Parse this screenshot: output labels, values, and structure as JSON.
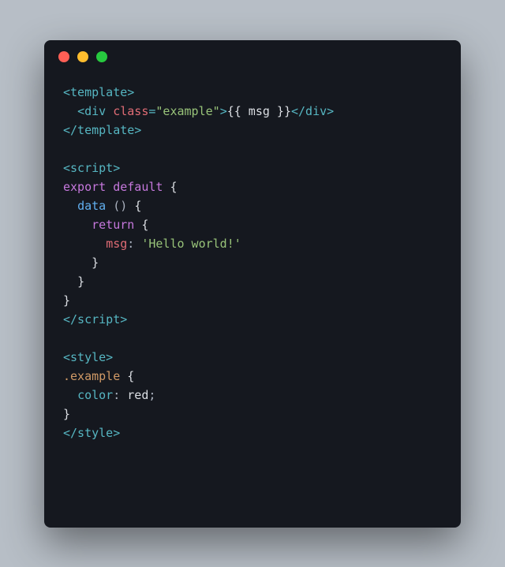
{
  "code": {
    "line1": {
      "open": "<template>"
    },
    "line2": {
      "indent": "  ",
      "lt": "<",
      "tag": "div",
      "sp": " ",
      "attr": "class",
      "eq": "=",
      "val": "\"example\"",
      "gt": ">",
      "mustache": "{{ msg }}",
      "close": "</div>"
    },
    "line3": {
      "close": "</template>"
    },
    "line5": {
      "open": "<script>"
    },
    "line6": {
      "kw1": "export",
      "sp1": " ",
      "kw2": "default",
      "sp2": " ",
      "brace": "{"
    },
    "line7": {
      "indent": "  ",
      "fn": "data",
      "sp": " ",
      "paren": "()",
      "sp2": " ",
      "brace": "{"
    },
    "line8": {
      "indent": "    ",
      "kw": "return",
      "sp": " ",
      "brace": "{"
    },
    "line9": {
      "indent": "      ",
      "prop": "msg",
      "colon": ":",
      "sp": " ",
      "val": "'Hello world!'"
    },
    "line10": {
      "indent": "    ",
      "brace": "}"
    },
    "line11": {
      "indent": "  ",
      "brace": "}"
    },
    "line12": {
      "brace": "}"
    },
    "line13": {
      "close": "</scr"
    },
    "line13b": {
      "close": "ipt>"
    },
    "line15": {
      "open": "<style>"
    },
    "line16": {
      "sel": ".example",
      "sp": " ",
      "brace": "{"
    },
    "line17": {
      "indent": "  ",
      "prop": "color",
      "colon": ":",
      "sp": " ",
      "val": "red",
      "semi": ";"
    },
    "line18": {
      "brace": "}"
    },
    "line19": {
      "close": "</style>"
    }
  }
}
